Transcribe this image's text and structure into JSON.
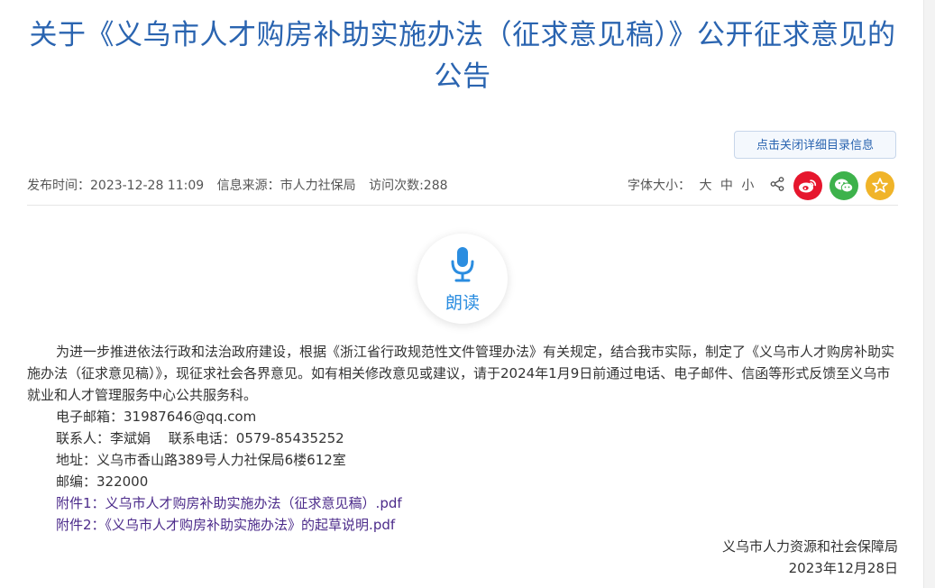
{
  "article": {
    "title": "关于《义乌市人才购房补助实施办法（征求意见稿）》公开征求意见的公告",
    "toggle_label": "点击关闭详细目录信息",
    "meta": {
      "publish": "发布时间：2023-12-28 11:09",
      "source": "信息来源：市人力社保局",
      "visits": "访问次数:288"
    },
    "font_size": {
      "label": "字体大小：",
      "large": "大",
      "medium": "中",
      "small": "小"
    },
    "read_label": "朗读",
    "body": {
      "intro": "为进一步推进依法行政和法治政府建设，根据《浙江省行政规范性文件管理办法》有关规定，结合我市实际，制定了《义乌市人才购房补助实施办法（征求意见稿）》，现征求社会各界意见。如有相关修改意见或建议，请于2024年1月9日前通过电话、电子邮件、信函等形式反馈至义乌市就业和人才管理服务中心公共服务科。",
      "email": "电子邮箱：31987646@qq.com",
      "contact": "联系人：李斌娟　 联系电话：0579-85435252",
      "address": "地址：义乌市香山路389号人力社保局6楼612室",
      "postcode": "邮编：322000",
      "attachment1": "附件1：义乌市人才购房补助实施办法（征求意见稿）.pdf",
      "attachment2": "附件2：《义乌市人才购房补助实施办法》的起草说明.pdf"
    },
    "signature": {
      "org": "义乌市人力资源和社会保障局",
      "date": "2023年12月28日"
    }
  },
  "colors": {
    "title": "#2a64b0",
    "weibo": "#e6162d",
    "wechat": "#3db24b",
    "favorite": "#f0b429",
    "read": "#2b8de0",
    "attachment": "#4b2a8a"
  },
  "icons": [
    "share-icon",
    "weibo-icon",
    "wechat-icon",
    "star-icon",
    "microphone-icon"
  ]
}
